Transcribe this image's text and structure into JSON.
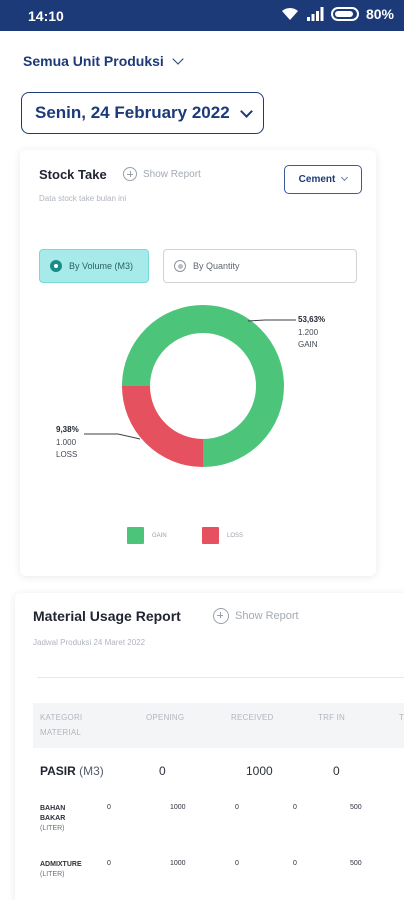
{
  "status_bar": {
    "time": "14:10",
    "battery": "80%"
  },
  "unit_selector": {
    "label": "Semua Unit Produksi"
  },
  "date_selector": {
    "label": "Senin, 24 February 2022"
  },
  "stock_take": {
    "title": "Stock Take",
    "show_report": "Show Report",
    "subtitle": "Data stock take bulan ini",
    "material_dropdown": "Cement",
    "options": [
      {
        "label": "By Volume (M3)",
        "selected": true
      },
      {
        "label": "By Quantity",
        "selected": false
      }
    ],
    "chart_data": {
      "type": "pie",
      "categories": [
        "GAIN",
        "LOSS"
      ],
      "values": [
        1200,
        1000
      ],
      "percent_labels": [
        "53,63%",
        "9,38%"
      ],
      "value_labels": [
        "1.200",
        "1.000"
      ],
      "shown_fraction": [
        0.75,
        0.25
      ],
      "colors": [
        "#4cc47a",
        "#e5515e"
      ],
      "legend_position": "bottom"
    },
    "callouts": {
      "gain": {
        "pct": "53,63%",
        "value": "1.200",
        "name": "GAIN"
      },
      "loss": {
        "pct": "9,38%",
        "value": "1.000",
        "name": "LOSS"
      }
    },
    "legend": [
      {
        "label": "GAIN",
        "color": "#4cc47a"
      },
      {
        "label": "LOSS",
        "color": "#e5515e"
      }
    ]
  },
  "material_usage": {
    "title": "Material Usage Report",
    "show_report": "Show Report",
    "subtitle": "Jadwal Produksi 24 Maret 2022",
    "columns": [
      "KATEGORI MATERIAL",
      "OPENING",
      "RECEIVED",
      "TRF IN",
      "T"
    ],
    "rows": [
      {
        "name": "PASIR",
        "unit": "(M3)",
        "values": [
          "0",
          "1000",
          "0"
        ]
      },
      {
        "name": "BAHAN BAKAR",
        "unit": "(LITER)",
        "values": [
          "0",
          "1000",
          "0",
          "0",
          "500"
        ]
      },
      {
        "name": "ADMIXTURE",
        "unit": "(LITER)",
        "values": [
          "0",
          "1000",
          "0",
          "0",
          "500"
        ]
      }
    ]
  }
}
